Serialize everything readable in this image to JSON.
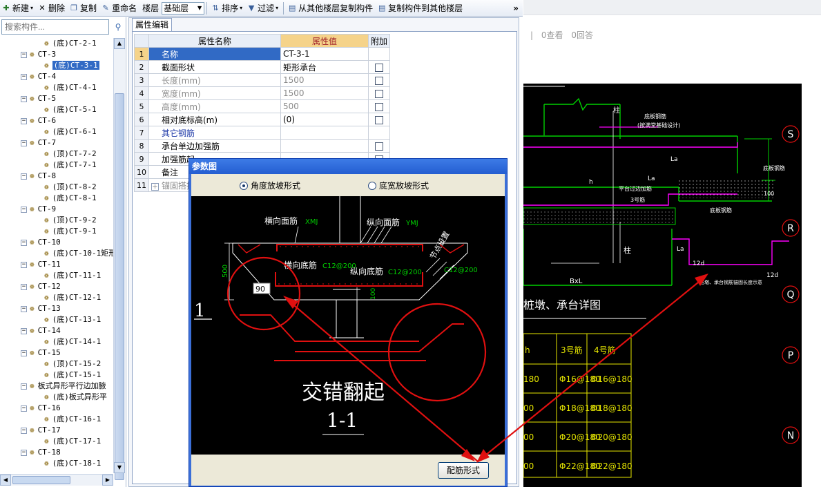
{
  "toolbar": {
    "new_label": "新建",
    "delete_label": "删除",
    "copy_label": "复制",
    "rename_label": "重命名",
    "floor_label": "楼层",
    "floor_value": "基础层",
    "sort_label": "排序",
    "filter_label": "过滤",
    "copy_from_floor_label": "从其他楼层复制构件",
    "copy_to_floor_label": "复制构件到其他楼层",
    "more_label": "»"
  },
  "search": {
    "placeholder": "搜索构件..."
  },
  "tree": {
    "items": [
      {
        "label": "(底)CT-2-1",
        "level": 2
      },
      {
        "label": "CT-3",
        "level": 1
      },
      {
        "label": "(底)CT-3-1",
        "level": 2,
        "selected": true
      },
      {
        "label": "CT-4",
        "level": 1
      },
      {
        "label": "(底)CT-4-1",
        "level": 2
      },
      {
        "label": "CT-5",
        "level": 1
      },
      {
        "label": "(底)CT-5-1",
        "level": 2
      },
      {
        "label": "CT-6",
        "level": 1
      },
      {
        "label": "(底)CT-6-1",
        "level": 2
      },
      {
        "label": "CT-7",
        "level": 1
      },
      {
        "label": "(顶)CT-7-2",
        "level": 2
      },
      {
        "label": "(底)CT-7-1",
        "level": 2
      },
      {
        "label": "CT-8",
        "level": 1
      },
      {
        "label": "(顶)CT-8-2",
        "level": 2
      },
      {
        "label": "(底)CT-8-1",
        "level": 2
      },
      {
        "label": "CT-9",
        "level": 1
      },
      {
        "label": "(顶)CT-9-2",
        "level": 2
      },
      {
        "label": "(底)CT-9-1",
        "level": 2
      },
      {
        "label": "CT-10",
        "level": 1
      },
      {
        "label": "(底)CT-10-1矩形",
        "level": 2
      },
      {
        "label": "CT-11",
        "level": 1
      },
      {
        "label": "(底)CT-11-1",
        "level": 2
      },
      {
        "label": "CT-12",
        "level": 1
      },
      {
        "label": "(底)CT-12-1",
        "level": 2
      },
      {
        "label": "CT-13",
        "level": 1
      },
      {
        "label": "(底)CT-13-1",
        "level": 2
      },
      {
        "label": "CT-14",
        "level": 1
      },
      {
        "label": "(底)CT-14-1",
        "level": 2
      },
      {
        "label": "CT-15",
        "level": 1
      },
      {
        "label": "(顶)CT-15-2",
        "level": 2
      },
      {
        "label": "(底)CT-15-1",
        "level": 2
      },
      {
        "label": "板式异形平行边加腋",
        "level": 1
      },
      {
        "label": "(底)板式异形平",
        "level": 2
      },
      {
        "label": "CT-16",
        "level": 1
      },
      {
        "label": "(底)CT-16-1",
        "level": 2
      },
      {
        "label": "CT-17",
        "level": 1
      },
      {
        "label": "(底)CT-17-1",
        "level": 2
      },
      {
        "label": "CT-18",
        "level": 1
      },
      {
        "label": "(底)CT-18-1",
        "level": 2
      }
    ]
  },
  "props": {
    "tab_label": "属性编辑",
    "col_name": "属性名称",
    "col_value": "属性值",
    "col_extra": "附加",
    "rows": [
      {
        "num": "1",
        "name": "名称",
        "value": "CT-3-1"
      },
      {
        "num": "2",
        "name": "截面形状",
        "value": "矩形承台"
      },
      {
        "num": "3",
        "name": "长度(mm)",
        "value": "1500"
      },
      {
        "num": "4",
        "name": "宽度(mm)",
        "value": "1500"
      },
      {
        "num": "5",
        "name": "高度(mm)",
        "value": "500"
      },
      {
        "num": "6",
        "name": "相对底标高(m)",
        "value": "(0)"
      },
      {
        "num": "7",
        "name": "其它钢筋",
        "value": ""
      },
      {
        "num": "8",
        "name": "承台单边加强筋",
        "value": ""
      },
      {
        "num": "9",
        "name": "加强筋起",
        "value": ""
      },
      {
        "num": "10",
        "name": "备注",
        "value": ""
      },
      {
        "num": "11",
        "name": "锚固搭接",
        "value": ""
      }
    ]
  },
  "dialog": {
    "title": "参数图",
    "radio1": "角度放坡形式",
    "radio2": "底宽放坡形式",
    "button": "配筋形式",
    "drawing": {
      "label_h_top": "横向面筋",
      "code_h_top": "XMJ",
      "label_v_top": "纵向面筋",
      "code_v_top": "YMJ",
      "label_h_bot": "横向底筋",
      "code_h_bot": "C12@200",
      "label_v_bot": "纵向底筋",
      "code_v_bot": "C12@200",
      "label_side": "节点设置",
      "code_side": "C12@200",
      "dim_height": "500",
      "dim_angle": "90",
      "dim_100": "100",
      "section_no": "1",
      "caption": "交错翻起",
      "section_label": "1-1"
    }
  },
  "web": {
    "stats_views": "0查看",
    "stats_answers": "0回答",
    "sep": "|",
    "cad": {
      "grid_labels": [
        "S",
        "R",
        "Q",
        "P",
        "N"
      ],
      "detail_title": "桩墩、承台详图",
      "table_headers": [
        "h",
        "3号筋",
        "4号筋"
      ],
      "table_rows": [
        [
          "180",
          "Φ16@180",
          "Φ16@180"
        ],
        [
          "00",
          "Φ18@180",
          "Φ18@180"
        ],
        [
          "00",
          "Φ20@180",
          "Φ20@180"
        ],
        [
          "00",
          "Φ22@180",
          "Φ22@180"
        ]
      ],
      "notes": [
        "底板钢筋",
        "(按满堂基础设计)",
        "平台过边加筋",
        "3号筋",
        "底板钢筋",
        "桩墩、承台钢筋锚固长度示意",
        "柱",
        "柱",
        "h",
        "La",
        "La",
        "La",
        "12d",
        "12d",
        "BxL",
        "100",
        "底板钢筋"
      ]
    }
  },
  "colors": {
    "selection": "#316ac5",
    "header_value": "#f5d38a",
    "annotation_red": "#e01010",
    "cad_green": "#00d000",
    "cad_yellow": "#e8e800",
    "cad_magenta": "#ff00ff"
  }
}
